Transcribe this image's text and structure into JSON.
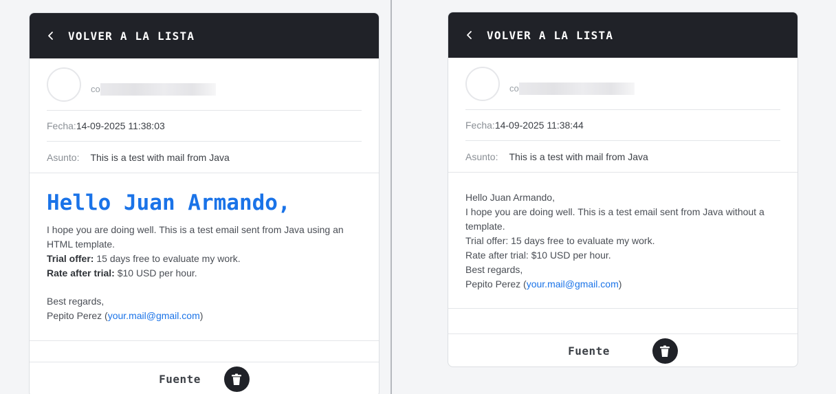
{
  "left_card": {
    "back_label": "VOLVER A LA LISTA",
    "sender_prefix": "co",
    "date_label": "Fecha:",
    "date_value": "14-09-2025 11:38:03",
    "subject_label": "Asunto:",
    "subject_value": "This is a test with mail from Java",
    "heading": "Hello Juan Armando,",
    "para1": "I hope you are doing well. This is a test email sent from Java using an HTML template.",
    "trial_label": "Trial offer:",
    "trial_value": " 15 days free to evaluate my work.",
    "rate_label": "Rate after trial:",
    "rate_value": " $10 USD per hour.",
    "regards": "Best regards,",
    "signature_name": "Pepito Perez (",
    "signature_email": "your.mail@gmail.com",
    "signature_close": ")",
    "source_label": "Fuente"
  },
  "right_card": {
    "back_label": "VOLVER A LA LISTA",
    "sender_prefix": "co",
    "date_label": "Fecha:",
    "date_value": "14-09-2025 11:38:44",
    "subject_label": "Asunto:",
    "subject_value": "This is a test with mail from Java",
    "line1": "Hello Juan Armando,",
    "line2": "I hope you are doing well. This is a test email sent from Java without a template.",
    "line3": "Trial offer: 15 days free to evaluate my work.",
    "line4": "Rate after trial: $10 USD per hour.",
    "line5": "Best regards,",
    "signature_name": "Pepito Perez (",
    "signature_email": "your.mail@gmail.com",
    "signature_close": ")",
    "source_label": "Fuente"
  },
  "icons": {
    "back": "chevron-left-icon",
    "delete": "trash-icon"
  },
  "colors": {
    "header_bg": "#202228",
    "heading_blue": "#1a73e8",
    "link_blue": "#1a73e8"
  }
}
